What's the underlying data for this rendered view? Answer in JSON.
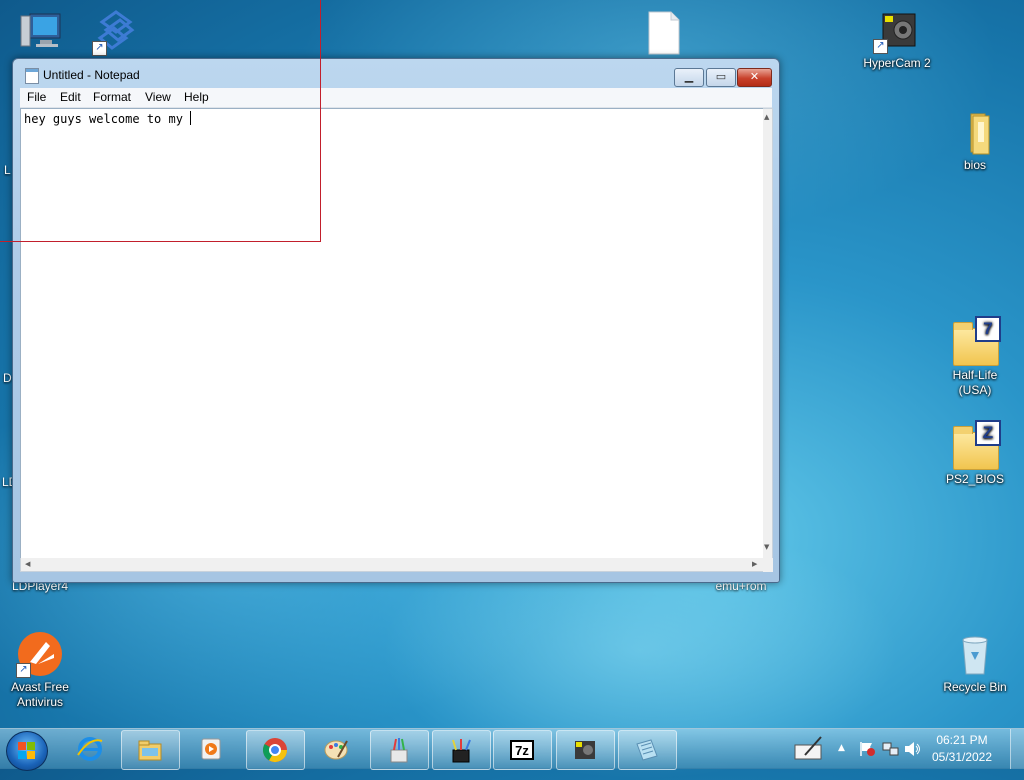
{
  "desktop": {
    "icons": {
      "hypercam": "HyperCam 2",
      "bios": "bios",
      "half_life": "Half-Life\n(USA)",
      "ps2_bios": "PS2_BIOS",
      "recycle_bin": "Recycle Bin",
      "avast": "Avast Free\nAntivirus",
      "ldplayer": "LDPlayer4",
      "emu_rom": "emu+rom"
    },
    "partial_labels": [
      "L",
      "D",
      "LD"
    ]
  },
  "notepad": {
    "title": "Untitled - Notepad",
    "menu": [
      "File",
      "Edit",
      "Format",
      "View",
      "Help"
    ],
    "text": "hey guys welcome to my "
  },
  "taskbar": {
    "pinned": [
      "internet-explorer-icon",
      "file-explorer-icon",
      "media-player-icon",
      "chrome-icon",
      "paint-icon",
      "paint-brush-app-icon",
      "art-app-icon",
      "7zip-icon",
      "hypercam-icon",
      "notepad-icon"
    ],
    "clock": {
      "time": "06:21 PM",
      "date": "05/31/2022"
    }
  },
  "colors": {
    "accent": "#1a63b8",
    "selection_border": "#c21f2c"
  }
}
